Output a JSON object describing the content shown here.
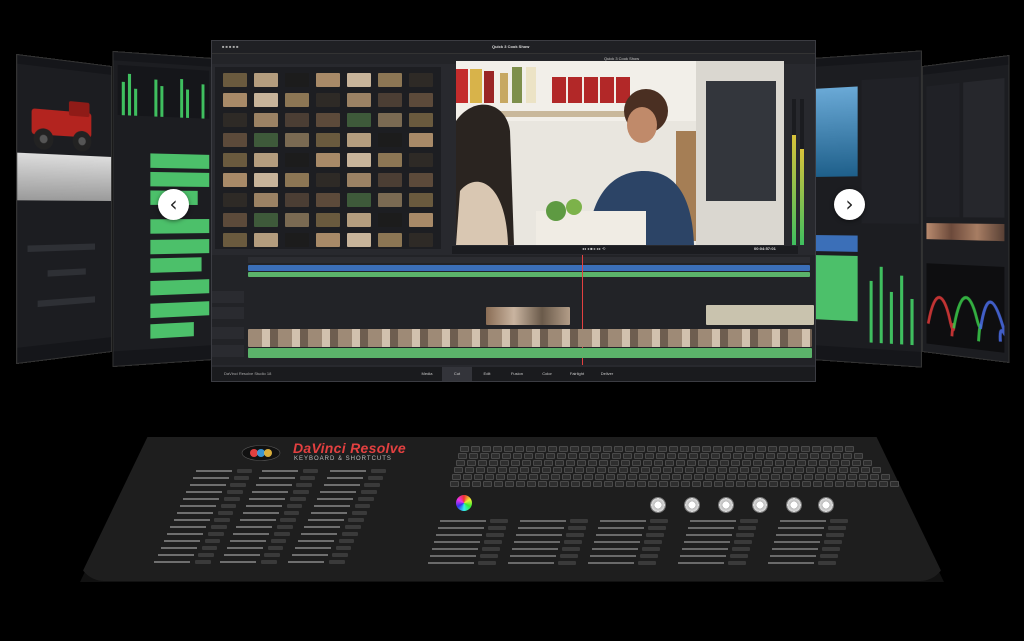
{
  "main": {
    "app_title": "Quick 3 Cook Show",
    "viewer_title": "Quick 3 Cook Show",
    "timecode": "00:04:57:01",
    "footer_brand": "DaVinci Resolve Studio 18",
    "page_tabs": [
      "Media",
      "Cut",
      "Edit",
      "Fusion",
      "Color",
      "Fairlight",
      "Deliver"
    ]
  },
  "nav": {
    "prev_icon": "chevron-left-icon",
    "next_icon": "chevron-right-icon",
    "prev_glyph": "‹",
    "next_glyph": "›"
  },
  "mat": {
    "brand": "DaVinci Resolve",
    "subtitle": "KEYBOARD & SHORTCUTS",
    "logo_icon": "davinci-logo-icon"
  },
  "colors": {
    "accent_red": "#e34040",
    "meter_green": "#3fbf5f",
    "clip_blue": "#3b6fb8",
    "audio_green": "#5bb36a"
  }
}
